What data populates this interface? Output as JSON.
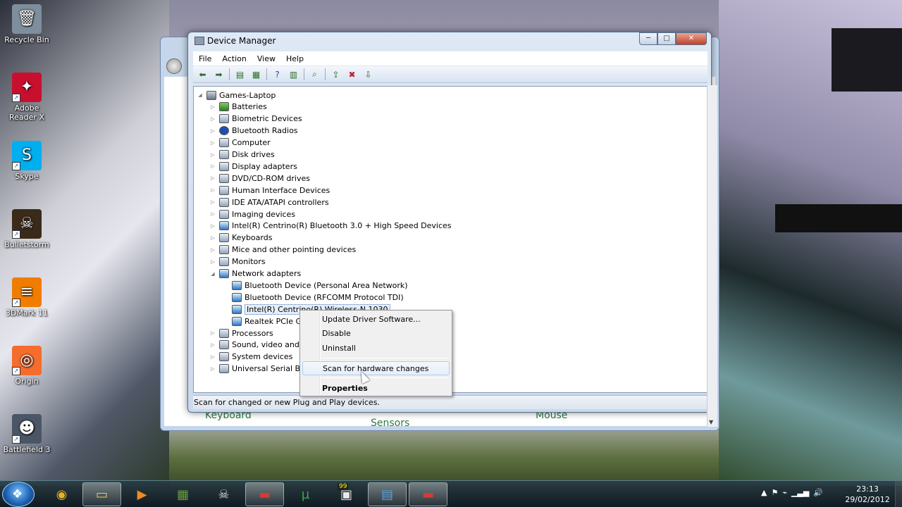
{
  "desktop": {
    "icons": [
      {
        "label": "Recycle Bin",
        "color": "#7e8e9c",
        "glyph": "🗑"
      },
      {
        "label": "Adobe Reader X",
        "color": "#c8102e",
        "glyph": "✦"
      },
      {
        "label": "Skype",
        "color": "#00aff0",
        "glyph": "S"
      },
      {
        "label": "Bulletstorm",
        "color": "#3a2a1a",
        "glyph": "☠"
      },
      {
        "label": "3DMark 11",
        "color": "#f07d00",
        "glyph": "≡"
      },
      {
        "label": "Origin",
        "color": "#f56c2d",
        "glyph": "◎"
      },
      {
        "label": "Battlefield 3",
        "color": "#4a5666",
        "glyph": "☻"
      }
    ],
    "background_labels": {
      "keyboard": "Keyboard",
      "sensors": "Sensors",
      "mouse": "Mouse"
    }
  },
  "window": {
    "title": "Device Manager",
    "controls": {
      "minimize": "─",
      "maximize": "□",
      "close": "✕"
    }
  },
  "menu": [
    "File",
    "Action",
    "View",
    "Help"
  ],
  "toolbar": [
    {
      "name": "back-icon",
      "glyph": "⬅"
    },
    {
      "name": "forward-icon",
      "glyph": "➡"
    },
    {
      "name": "show-hide-console-tree-icon",
      "glyph": "▤"
    },
    {
      "name": "properties-icon",
      "glyph": "▦"
    },
    {
      "name": "help-icon",
      "glyph": "?"
    },
    {
      "name": "show-hide-action-pane-icon",
      "glyph": "▥"
    },
    {
      "name": "scan-hardware-icon",
      "glyph": "⌕"
    },
    {
      "name": "update-driver-icon",
      "glyph": "⇪"
    },
    {
      "name": "uninstall-icon",
      "glyph": "✖"
    },
    {
      "name": "disable-icon",
      "glyph": "⇩"
    }
  ],
  "tree": [
    {
      "label": "Games-Laptop",
      "level": 0,
      "expander": "◢",
      "icon": "root"
    },
    {
      "label": "Batteries",
      "level": 1,
      "expander": "▷",
      "icon": "bat"
    },
    {
      "label": "Biometric Devices",
      "level": 1,
      "expander": "▷",
      "icon": "dev"
    },
    {
      "label": "Bluetooth Radios",
      "level": 1,
      "expander": "▷",
      "icon": "bt"
    },
    {
      "label": "Computer",
      "level": 1,
      "expander": "▷",
      "icon": "dev"
    },
    {
      "label": "Disk drives",
      "level": 1,
      "expander": "▷",
      "icon": "dev"
    },
    {
      "label": "Display adapters",
      "level": 1,
      "expander": "▷",
      "icon": "dev"
    },
    {
      "label": "DVD/CD-ROM drives",
      "level": 1,
      "expander": "▷",
      "icon": "dev"
    },
    {
      "label": "Human Interface Devices",
      "level": 1,
      "expander": "▷",
      "icon": "dev"
    },
    {
      "label": "IDE ATA/ATAPI controllers",
      "level": 1,
      "expander": "▷",
      "icon": "dev"
    },
    {
      "label": "Imaging devices",
      "level": 1,
      "expander": "▷",
      "icon": "dev"
    },
    {
      "label": "Intel(R) Centrino(R) Bluetooth 3.0 + High Speed Devices",
      "level": 1,
      "expander": "▷",
      "icon": "net"
    },
    {
      "label": "Keyboards",
      "level": 1,
      "expander": "▷",
      "icon": "dev"
    },
    {
      "label": "Mice and other pointing devices",
      "level": 1,
      "expander": "▷",
      "icon": "dev"
    },
    {
      "label": "Monitors",
      "level": 1,
      "expander": "▷",
      "icon": "dev"
    },
    {
      "label": "Network adapters",
      "level": 1,
      "expander": "◢",
      "icon": "net"
    },
    {
      "label": "Bluetooth Device (Personal Area Network)",
      "level": 2,
      "expander": "",
      "icon": "net"
    },
    {
      "label": "Bluetooth Device (RFCOMM Protocol TDI)",
      "level": 2,
      "expander": "",
      "icon": "net"
    },
    {
      "label": "Intel(R) Centrino(R) Wireless-N 1030",
      "level": 2,
      "expander": "",
      "icon": "net",
      "selected": true
    },
    {
      "label": "Realtek PCIe GBE Family Controller",
      "level": 2,
      "expander": "",
      "icon": "net"
    },
    {
      "label": "Processors",
      "level": 1,
      "expander": "▷",
      "icon": "dev"
    },
    {
      "label": "Sound, video and game controllers",
      "level": 1,
      "expander": "▷",
      "icon": "dev"
    },
    {
      "label": "System devices",
      "level": 1,
      "expander": "▷",
      "icon": "dev"
    },
    {
      "label": "Universal Serial Bus controllers",
      "level": 1,
      "expander": "▷",
      "icon": "dev"
    }
  ],
  "context_menu": {
    "items": [
      {
        "label": "Update Driver Software...",
        "bold": false,
        "hover": false
      },
      {
        "label": "Disable",
        "bold": false,
        "hover": false
      },
      {
        "label": "Uninstall",
        "bold": false,
        "hover": false
      },
      {
        "separator": true
      },
      {
        "label": "Scan for hardware changes",
        "bold": false,
        "hover": true
      },
      {
        "separator": true
      },
      {
        "label": "Properties",
        "bold": true,
        "hover": false
      }
    ]
  },
  "status_text": "Scan for changed or new Plug and Play devices.",
  "taskbar": {
    "buttons": [
      {
        "name": "chrome-icon",
        "glyph": "◉",
        "color": "#e8b020",
        "active": false
      },
      {
        "name": "explorer-icon",
        "glyph": "▭",
        "color": "#f2c94c",
        "active": true
      },
      {
        "name": "media-player-icon",
        "glyph": "▶",
        "color": "#f08a24",
        "active": false
      },
      {
        "name": "minecraft-icon",
        "glyph": "▦",
        "color": "#6a9a3a",
        "active": false
      },
      {
        "name": "bulletstorm-icon",
        "glyph": "☠",
        "color": "#d9d9d9",
        "active": false
      },
      {
        "name": "toolbox-icon",
        "glyph": "▬",
        "color": "#d33a3a",
        "active": true
      },
      {
        "name": "utorrent-icon",
        "glyph": "µ",
        "color": "#3aa84a",
        "active": false
      },
      {
        "name": "monitor-icon",
        "glyph": "▣",
        "color": "#e9e9e9",
        "active": false
      },
      {
        "name": "control-panel-icon",
        "glyph": "▤",
        "color": "#5aa0e0",
        "active": true
      },
      {
        "name": "device-manager-icon",
        "glyph": "▬",
        "color": "#d33a3a",
        "active": true
      }
    ],
    "badge_99": "99",
    "tray_icons": [
      {
        "name": "show-hidden-icons-icon",
        "glyph": "▲"
      },
      {
        "name": "action-center-flag-icon",
        "glyph": "⚑"
      },
      {
        "name": "power-icon",
        "glyph": "⌁"
      },
      {
        "name": "network-signal-icon",
        "glyph": "▁▃▅"
      },
      {
        "name": "volume-icon",
        "glyph": "🔊"
      }
    ],
    "clock_time": "23:13",
    "clock_date": "29/02/2012"
  }
}
